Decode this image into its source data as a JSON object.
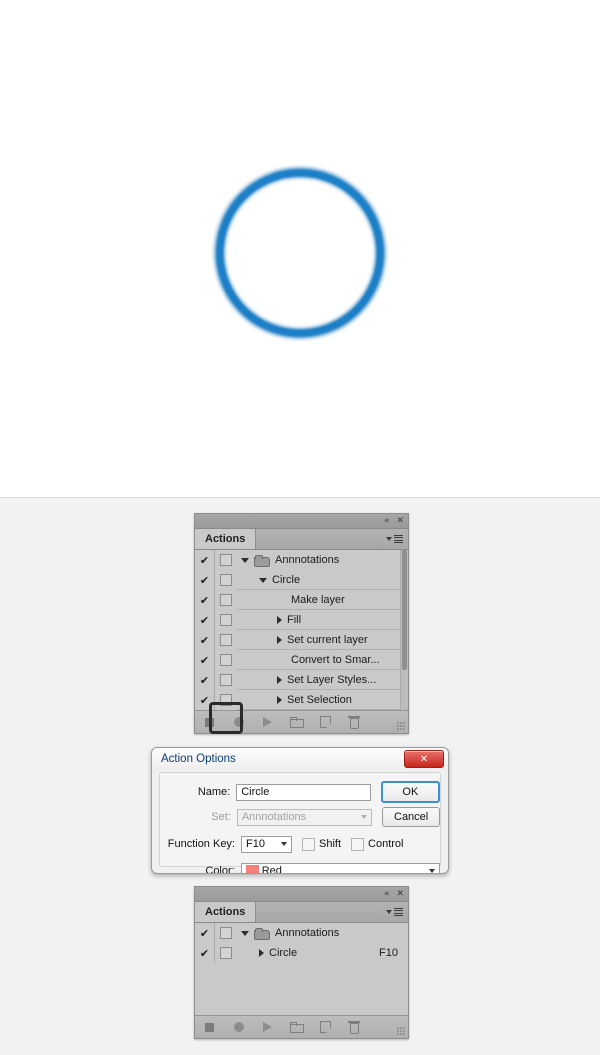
{
  "canvas": {
    "artwork_name": "blue-circle",
    "stroke_color": "#1878bd",
    "background": "#ffffff"
  },
  "panel_top": {
    "topbar": {
      "collapse_icon": "double-chevron-left-icon",
      "collapse_glyph": "«",
      "close_icon": "close-icon",
      "close_glyph": "✕"
    },
    "tab_label": "Actions",
    "menu_icon": "panel-menu-icon",
    "rows": [
      {
        "checked": "✔",
        "toggle": "",
        "indent": 1,
        "disclosure": "down",
        "icon": "folder",
        "label": "Annnotations",
        "fkey": ""
      },
      {
        "checked": "✔",
        "toggle": "",
        "indent": 2,
        "disclosure": "down",
        "icon": "",
        "label": "Circle",
        "fkey": ""
      },
      {
        "checked": "✔",
        "toggle": "",
        "indent": 3,
        "disclosure": "none",
        "icon": "",
        "label": "Make layer",
        "fkey": ""
      },
      {
        "checked": "✔",
        "toggle": "",
        "indent": 3,
        "disclosure": "right",
        "icon": "",
        "label": "Fill",
        "fkey": ""
      },
      {
        "checked": "✔",
        "toggle": "",
        "indent": 3,
        "disclosure": "right",
        "icon": "",
        "label": "Set current layer",
        "fkey": ""
      },
      {
        "checked": "✔",
        "toggle": "",
        "indent": 3,
        "disclosure": "none",
        "icon": "",
        "label": "Convert to Smar...",
        "fkey": ""
      },
      {
        "checked": "✔",
        "toggle": "",
        "indent": 3,
        "disclosure": "right",
        "icon": "",
        "label": "Set Layer Styles...",
        "fkey": ""
      },
      {
        "checked": "✔",
        "toggle": "",
        "indent": 3,
        "disclosure": "right",
        "icon": "",
        "label": "Set Selection",
        "fkey": ""
      }
    ],
    "bottom_buttons": [
      {
        "name": "stop-button",
        "icon": "stop-square-icon"
      },
      {
        "name": "record-button",
        "icon": "record-circle-icon"
      },
      {
        "name": "play-button",
        "icon": "play-triangle-icon"
      },
      {
        "name": "new-set-button",
        "icon": "folder-icon"
      },
      {
        "name": "new-action-button",
        "icon": "new-document-icon"
      },
      {
        "name": "delete-button",
        "icon": "trash-icon"
      }
    ],
    "highlighted_button": "stop-button"
  },
  "dialog": {
    "title": "Action Options",
    "close_glyph": "✕",
    "close_icon": "close-icon",
    "fields": {
      "name_label": "Name:",
      "name_value": "Circle",
      "set_label": "Set:",
      "set_value": "Annnotations",
      "function_key_label": "Function Key:",
      "function_key_value": "F10",
      "shift_label": "Shift",
      "shift_checked": false,
      "control_label": "Control",
      "control_checked": false,
      "color_label": "Color:",
      "color_value": "Red",
      "color_hex": "#f4817c"
    },
    "buttons": {
      "ok": "OK",
      "cancel": "Cancel"
    }
  },
  "panel_bottom": {
    "topbar": {
      "collapse_glyph": "«",
      "close_glyph": "✕"
    },
    "tab_label": "Actions",
    "rows": [
      {
        "checked": "✔",
        "indent": 1,
        "disclosure": "down",
        "icon": "folder",
        "label": "Annnotations",
        "fkey": ""
      },
      {
        "checked": "✔",
        "indent": 2,
        "disclosure": "right",
        "icon": "",
        "label": "Circle",
        "fkey": "F10"
      }
    ],
    "bottom_buttons": [
      {
        "name": "stop-button",
        "icon": "stop-square-icon"
      },
      {
        "name": "record-button",
        "icon": "record-circle-icon"
      },
      {
        "name": "play-button",
        "icon": "play-triangle-icon"
      },
      {
        "name": "new-set-button",
        "icon": "folder-icon"
      },
      {
        "name": "new-action-button",
        "icon": "new-document-icon"
      },
      {
        "name": "delete-button",
        "icon": "trash-icon"
      }
    ]
  }
}
